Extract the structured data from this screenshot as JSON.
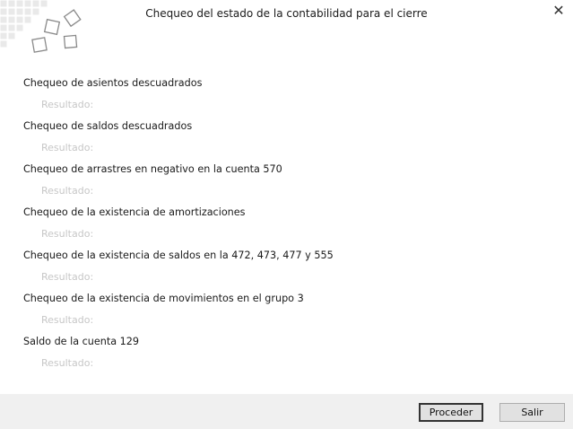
{
  "window": {
    "title": "Chequeo del estado de la contabilidad para el cierre",
    "close_glyph": "✕"
  },
  "checks": [
    {
      "label": "Chequeo de asientos descuadrados",
      "result": "Resultado:"
    },
    {
      "label": "Chequeo de saldos descuadrados",
      "result": "Resultado:"
    },
    {
      "label": "Chequeo de arrastres en negativo en la cuenta 570",
      "result": "Resultado:"
    },
    {
      "label": "Chequeo de la existencia de amortizaciones",
      "result": "Resultado:"
    },
    {
      "label": "Chequeo de la existencia de saldos en la 472, 473, 477 y 555",
      "result": "Resultado:"
    },
    {
      "label": "Chequeo de la existencia de movimientos en el grupo 3",
      "result": "Resultado:"
    },
    {
      "label": "Saldo de la cuenta 129",
      "result": "Resultado:"
    }
  ],
  "footer": {
    "proceed_label": "Proceder",
    "exit_label": "Salir"
  },
  "colors": {
    "footer_bg": "#f0f0f0",
    "result_text": "#c7c7c7",
    "logo_stroke": "#8a8a8a",
    "logo_grid": "#e6e6e6"
  }
}
